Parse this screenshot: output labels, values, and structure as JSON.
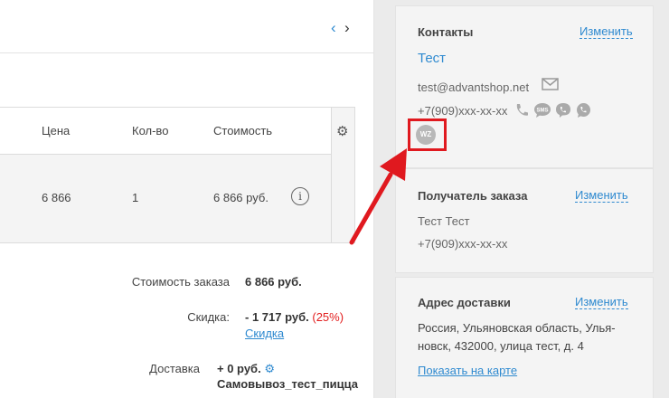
{
  "pager": {
    "prev_icon": "‹",
    "next_icon": "›"
  },
  "table": {
    "headers": {
      "price": "Цена",
      "qty": "Кол-во",
      "cost": "Стоимость"
    },
    "row": {
      "price": "6 866",
      "qty": "1",
      "cost": "6 866 руб."
    }
  },
  "summary": {
    "order_cost_label": "Стоимость заказа",
    "order_cost_value": "6 866 руб.",
    "discount_label": "Скидка:",
    "discount_value": "- 1 717 руб.",
    "discount_percent": "(25%)",
    "discount_link": "Скидка",
    "delivery_label": "Доставка",
    "delivery_value": "+ 0 руб.",
    "delivery_method": "Самовывоз_тест_пицца"
  },
  "contacts": {
    "title": "Контакты",
    "edit": "Изменить",
    "name": "Тест",
    "email": "test@advantshop.net",
    "phone": "+7(909)xxx-xx-xx",
    "wz_badge": "WZ"
  },
  "recipient": {
    "title": "Получатель заказа",
    "edit": "Изменить",
    "name": "Тест Тест",
    "phone": "+7(909)xxx-xx-xx"
  },
  "address": {
    "title": "Адрес доставки",
    "edit": "Изменить",
    "line1": "Россия, Ульяновская область, Улья-",
    "line2": "новск, 432000, улица тест, д. 4",
    "map_link": "Показать на карте"
  },
  "colors": {
    "link": "#2f8ad0",
    "highlight": "#e0191f",
    "arrow": "#e0191f"
  }
}
